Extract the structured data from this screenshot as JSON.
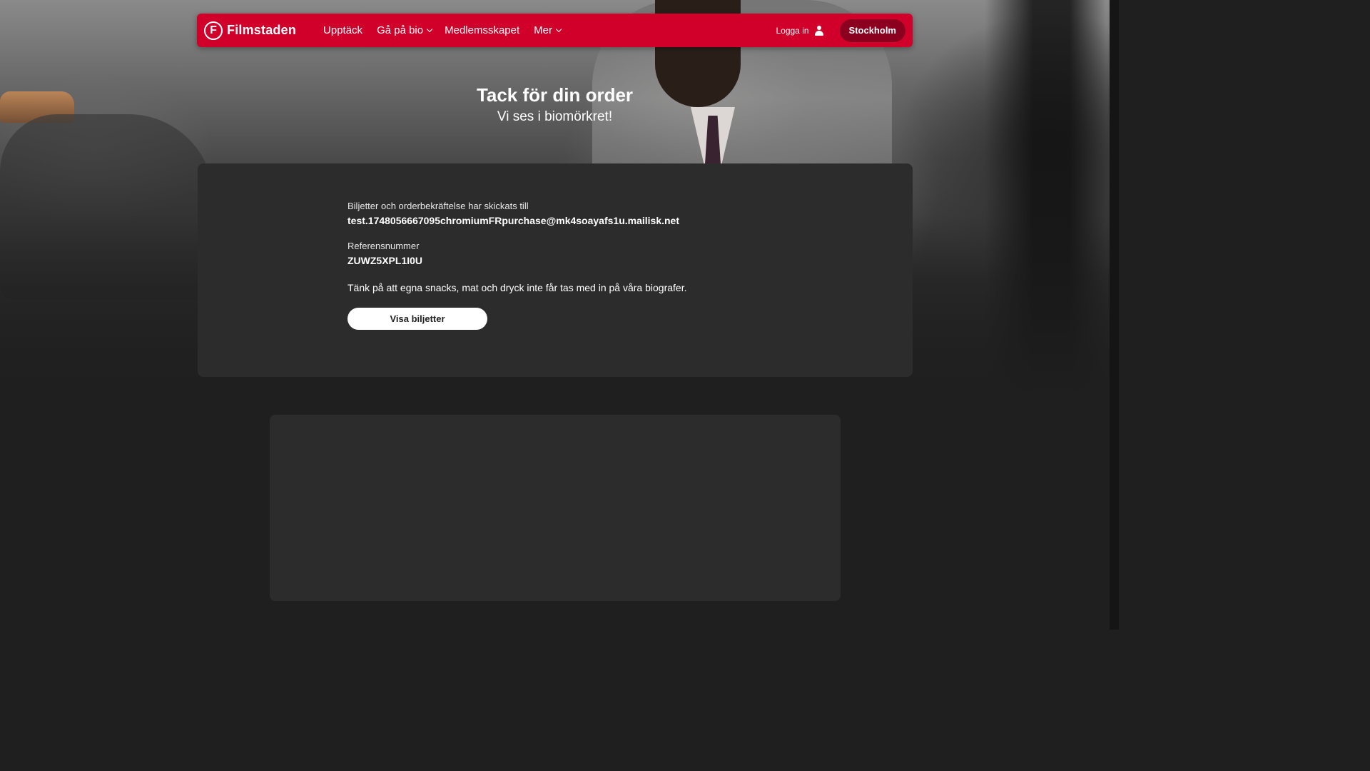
{
  "brand": {
    "logo_mark": "F",
    "name": "Filmstaden",
    "accent_color": "#d0002a"
  },
  "nav": {
    "links": [
      {
        "label": "Upptäck",
        "has_dropdown": false
      },
      {
        "label": "Gå på bio",
        "has_dropdown": true
      },
      {
        "label": "Medlemsskapet",
        "has_dropdown": false
      },
      {
        "label": "Mer",
        "has_dropdown": true
      }
    ],
    "login_label": "Logga in",
    "login_icon": "user-icon",
    "city_label": "Stockholm"
  },
  "hero": {
    "title": "Tack för din order",
    "subtitle": "Vi ses i biomörkret!"
  },
  "confirmation": {
    "sent_to_label": "Biljetter och orderbekräftelse har skickats till",
    "email": "test.1748056667095chromiumFRpurchase@mk4soayafs1u.mailisk.net",
    "reference_label": "Referensnummer",
    "reference_number": "ZUWZ5XPL1I0U",
    "notice": "Tänk på att egna snacks, mat och dryck inte får tas med in på våra biografer.",
    "show_tickets_label": "Visa biljetter"
  }
}
